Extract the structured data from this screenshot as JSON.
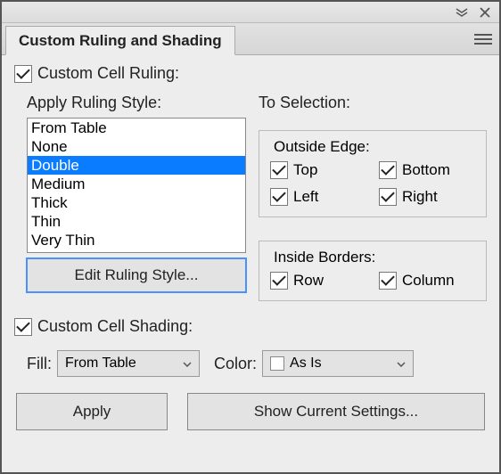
{
  "window": {
    "title": "Custom Ruling and Shading"
  },
  "ruling": {
    "checkbox_label": "Custom Cell Ruling:",
    "checked": true,
    "apply_label": "Apply Ruling Style:",
    "styles": [
      "From Table",
      "None",
      "Double",
      "Medium",
      "Thick",
      "Thin",
      "Very Thin"
    ],
    "selected_index": 2,
    "edit_button": "Edit Ruling Style...",
    "to_selection_label": "To Selection:",
    "outside_edge": {
      "legend": "Outside Edge:",
      "top": {
        "label": "Top",
        "checked": true
      },
      "bottom": {
        "label": "Bottom",
        "checked": true
      },
      "left": {
        "label": "Left",
        "checked": true
      },
      "right": {
        "label": "Right",
        "checked": true
      }
    },
    "inside_borders": {
      "legend": "Inside Borders:",
      "row": {
        "label": "Row",
        "checked": true
      },
      "column": {
        "label": "Column",
        "checked": true
      }
    }
  },
  "shading": {
    "checkbox_label": "Custom Cell Shading:",
    "checked": true,
    "fill_label": "Fill:",
    "fill_value": "From Table",
    "color_label": "Color:",
    "color_value": "As Is"
  },
  "footer": {
    "apply": "Apply",
    "show_current": "Show Current Settings..."
  }
}
